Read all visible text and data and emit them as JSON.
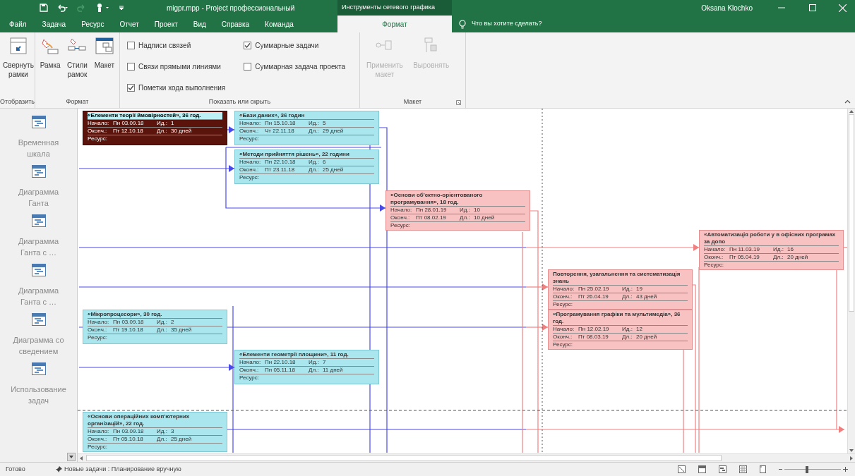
{
  "title_bar": {
    "title": "migpr.mpp  -  Project профессиональный",
    "context_group": "Инструменты сетевого графика",
    "user": "Oksana Klochko"
  },
  "ribbon_tabs": [
    {
      "label": "Файл",
      "selected": false
    },
    {
      "label": "Задача",
      "selected": false
    },
    {
      "label": "Ресурс",
      "selected": false
    },
    {
      "label": "Отчет",
      "selected": false
    },
    {
      "label": "Проект",
      "selected": false
    },
    {
      "label": "Вид",
      "selected": false
    },
    {
      "label": "Справка",
      "selected": false
    },
    {
      "label": "Команда",
      "selected": false
    },
    {
      "label": "Формат",
      "selected": true
    }
  ],
  "tell_me": {
    "placeholder": "Что вы хотите сделать?"
  },
  "ribbon_groups": [
    {
      "label": "Отобразить",
      "controls": [
        {
          "kind": "button",
          "label": "Свернуть рамки",
          "disabled": false
        }
      ]
    },
    {
      "label": "Формат",
      "controls": [
        {
          "kind": "button",
          "label": "Рамка",
          "disabled": false
        },
        {
          "kind": "button",
          "label": "Стили рамок",
          "disabled": false
        },
        {
          "kind": "button",
          "label": "Макет",
          "disabled": false
        }
      ]
    },
    {
      "label": "Показать или скрыть",
      "controls": [
        {
          "kind": "checkbox",
          "label": "Надписи связей",
          "checked": false
        },
        {
          "kind": "checkbox",
          "label": "Связи прямыми линиями",
          "checked": false
        },
        {
          "kind": "checkbox",
          "label": "Пометки хода выполнения",
          "checked": true
        },
        {
          "kind": "checkbox",
          "label": "Суммарные задачи",
          "checked": true
        },
        {
          "kind": "checkbox",
          "label": "Суммарная задача проекта",
          "checked": false
        }
      ]
    },
    {
      "label": "Макет",
      "controls": [
        {
          "kind": "button",
          "label": "Применить макет",
          "disabled": true
        },
        {
          "kind": "button",
          "label": "Выровнять",
          "disabled": true
        }
      ]
    }
  ],
  "sidebar": {
    "items": [
      {
        "label": "Временная шкала"
      },
      {
        "label": "Диаграмма Ганта"
      },
      {
        "label": "Диаграмма Ганта с …"
      },
      {
        "label": "Диаграмма Ганта с …"
      },
      {
        "label": "Диаграмма со сведением"
      },
      {
        "label": "Использование задач"
      }
    ]
  },
  "nodes": [
    {
      "title": "«Елементи теорії ймовірностей», 36 год.",
      "start_label": "Начало:",
      "start": "Пн 03.09.18",
      "id_label": "Ид.:",
      "id": "1",
      "finish_label": "Оконч.:",
      "finish": "Пт 12.10.18",
      "duration_label": "Дл.:",
      "duration": "30 дней",
      "resource_label": "Ресурс:",
      "critical": false,
      "selected": true
    },
    {
      "title": "«Бази даних», 36 годин",
      "start_label": "Начало:",
      "start": "Пн 15.10.18",
      "id_label": "Ид.:",
      "id": "5",
      "finish_label": "Оконч.:",
      "finish": "Чт 22.11.18",
      "duration_label": "Дл.:",
      "duration": "29 дней",
      "resource_label": "Ресурс:",
      "critical": false,
      "selected": false
    },
    {
      "title": "«Методи прийняття рішень», 22 години",
      "start_label": "Начало:",
      "start": "Пн 22.10.18",
      "id_label": "Ид.:",
      "id": "6",
      "finish_label": "Оконч.:",
      "finish": "Пт 23.11.18",
      "duration_label": "Дл.:",
      "duration": "25 дней",
      "resource_label": "Ресурс:",
      "critical": false,
      "selected": false
    },
    {
      "title": "«Основи об'єктно-орієнтованого програмування», 18 год.",
      "start_label": "Начало:",
      "start": "Пн 28.01.19",
      "id_label": "Ид.:",
      "id": "10",
      "finish_label": "Оконч.:",
      "finish": "Пт 08.02.19",
      "duration_label": "Дл.:",
      "duration": "10 дней",
      "resource_label": "Ресурс:",
      "critical": true,
      "selected": false
    },
    {
      "title": "«Автоматизація роботи у в офісних програмах за допо",
      "start_label": "Начало:",
      "start": "Пн 11.03.19",
      "id_label": "Ид.:",
      "id": "16",
      "finish_label": "Оконч.:",
      "finish": "Пт 05.04.19",
      "duration_label": "Дл.:",
      "duration": "20 дней",
      "resource_label": "Ресурс:",
      "critical": true,
      "selected": false
    },
    {
      "title": "Повторення, узагальнення та систематизація знань",
      "start_label": "Начало:",
      "start": "Пн 25.02.19",
      "id_label": "Ид.:",
      "id": "19",
      "finish_label": "Оконч.:",
      "finish": "Пт 26.04.19",
      "duration_label": "Дл.:",
      "duration": "43 дней",
      "resource_label": "Ресурс:",
      "critical": true,
      "selected": false
    },
    {
      "title": "«Мікропроцесори», 30 год.",
      "start_label": "Начало:",
      "start": "Пн 03.09.18",
      "id_label": "Ид.:",
      "id": "2",
      "finish_label": "Оконч.:",
      "finish": "Пт 19.10.18",
      "duration_label": "Дл.:",
      "duration": "35 дней",
      "resource_label": "Ресурс:",
      "critical": false,
      "selected": false
    },
    {
      "title": "«Програмування графіки та мультимедіа», 36 год.",
      "start_label": "Начало:",
      "start": "Пн 12.02.19",
      "id_label": "Ид.:",
      "id": "12",
      "finish_label": "Оконч.:",
      "finish": "Пт 08.03.19",
      "duration_label": "Дл.:",
      "duration": "20 дней",
      "resource_label": "Ресурс:",
      "critical": true,
      "selected": false
    },
    {
      "title": "«Елементи геометрії площини», 11 год.",
      "start_label": "Начало:",
      "start": "Пн 22.10.18",
      "id_label": "Ид.:",
      "id": "7",
      "finish_label": "Оконч.:",
      "finish": "Пн 05.11.18",
      "duration_label": "Дл.:",
      "duration": "11 дней",
      "resource_label": "Ресурс:",
      "critical": false,
      "selected": false
    },
    {
      "title": "«Основи операційних комп'ютерних організацій», 22 год.",
      "start_label": "Начало:",
      "start": "Пн 03.09.18",
      "id_label": "Ид.:",
      "id": "3",
      "finish_label": "Оконч.:",
      "finish": "Пт 05.10.18",
      "duration_label": "Дл.:",
      "duration": "25 дней",
      "resource_label": "Ресурс:",
      "critical": false,
      "selected": false
    }
  ],
  "status_bar": {
    "ready": "Готово",
    "task_mode": "Новые задачи : Планирование вручную",
    "zoom": {
      "level": 0.4
    }
  }
}
